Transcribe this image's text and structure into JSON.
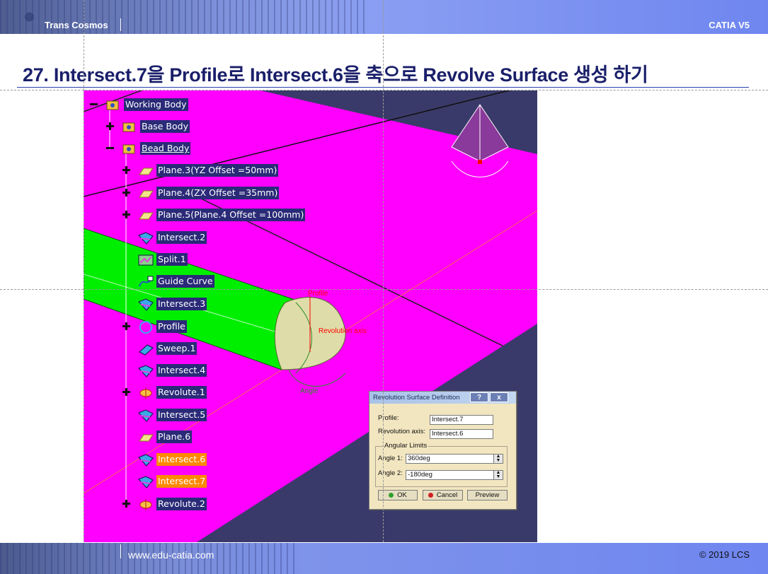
{
  "header": {
    "brand": "Trans Cosmos",
    "product": "CATIA V5"
  },
  "title": "27. Intersect.7을 Profile로 Intersect.6을 축으로 Revolve Surface 생성 하기",
  "tree": [
    {
      "label": "Working Body",
      "expander": "minus",
      "icon": "body-icon"
    },
    {
      "label": "Base Body",
      "expander": "plus",
      "icon": "body-icon"
    },
    {
      "label": "Bead Body",
      "expander": "minus",
      "icon": "body-icon"
    },
    {
      "label": "Plane.3(YZ Offset =50mm)",
      "expander": "plus",
      "icon": "plane-icon"
    },
    {
      "label": "Plane.4(ZX Offset =35mm)",
      "expander": "plus",
      "icon": "plane-icon"
    },
    {
      "label": "Plane.5(Plane.4 Offset =100mm)",
      "expander": "plus",
      "icon": "plane-icon"
    },
    {
      "label": "Intersect.2",
      "expander": "none",
      "icon": "intersect-icon"
    },
    {
      "label": "Split.1",
      "expander": "none",
      "icon": "split-icon"
    },
    {
      "label": "Guide Curve",
      "expander": "none",
      "icon": "curve-icon"
    },
    {
      "label": "Intersect.3",
      "expander": "none",
      "icon": "intersect-icon"
    },
    {
      "label": "Profile",
      "expander": "plus",
      "icon": "circle-icon"
    },
    {
      "label": "Sweep.1",
      "expander": "none",
      "icon": "sweep-icon"
    },
    {
      "label": "Intersect.4",
      "expander": "none",
      "icon": "intersect-icon"
    },
    {
      "label": "Revolute.1",
      "expander": "plus",
      "icon": "revolute-icon"
    },
    {
      "label": "Intersect.5",
      "expander": "none",
      "icon": "intersect-icon"
    },
    {
      "label": "Plane.6",
      "expander": "none",
      "icon": "plane-icon"
    },
    {
      "label": "Intersect.6",
      "expander": "none",
      "icon": "intersect-icon",
      "selected": true
    },
    {
      "label": "Intersect.7",
      "expander": "none",
      "icon": "intersect-icon",
      "selected": true
    },
    {
      "label": "Revolute.2",
      "expander": "plus",
      "icon": "revolute-icon"
    }
  ],
  "annotations": {
    "profile": "Profile",
    "axis": "Revolution axis",
    "angle": "Angle"
  },
  "dialog": {
    "title": "Revolution Surface Definition",
    "help": "?",
    "close": "x",
    "profile_label": "Profile:",
    "profile_value": "Intersect.7",
    "axis_label": "Revolution axis:",
    "axis_value": "Intersect.6",
    "group_title": "Angular Limits",
    "angle1_label": "Angle 1:",
    "angle1_value": "360deg",
    "angle2_label": "Angle 2:",
    "angle2_value": "-180deg",
    "ok": "OK",
    "cancel": "Cancel",
    "preview": "Preview"
  },
  "footer": {
    "site": "www.edu-catia.com",
    "copyright": "© 2019 LCS"
  },
  "colors": {
    "background": "#ff00ff",
    "selected": "#ff8800",
    "label_bg": "#2a2a78",
    "tube": "#00ee00",
    "floor": "#3a3a6a"
  }
}
